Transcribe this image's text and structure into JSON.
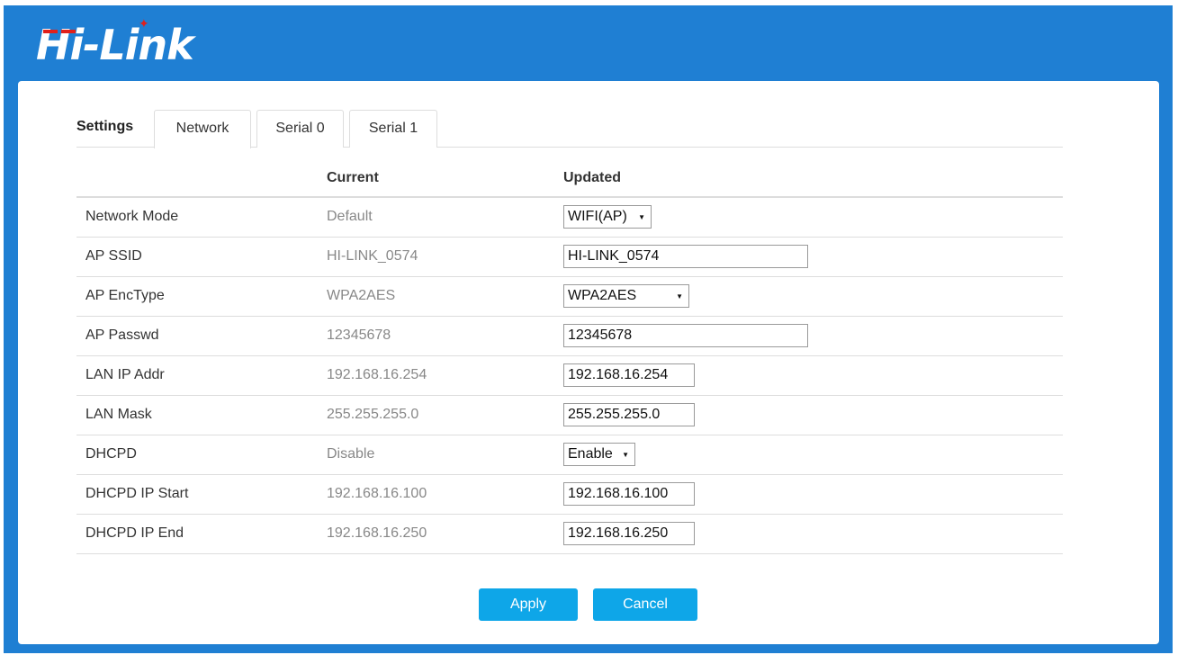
{
  "brand": {
    "logo_text": "Hi-Link",
    "accent": "#1f7fd3",
    "logo_mark_color": "#e0201c"
  },
  "tabs": {
    "section_label": "Settings",
    "items": [
      {
        "label": "Network",
        "active": true
      },
      {
        "label": "Serial 0",
        "active": false
      },
      {
        "label": "Serial 1",
        "active": false
      }
    ]
  },
  "table": {
    "headers": {
      "label": "",
      "current": "Current",
      "updated": "Updated"
    },
    "rows": [
      {
        "label": "Network Mode",
        "current": "Default",
        "updated": "WIFI(AP)",
        "control": "select"
      },
      {
        "label": "AP SSID",
        "current": "HI-LINK_0574",
        "updated": "HI-LINK_0574",
        "control": "input"
      },
      {
        "label": "AP EncType",
        "current": "WPA2AES",
        "updated": "WPA2AES",
        "control": "select"
      },
      {
        "label": "AP Passwd",
        "current": "12345678",
        "updated": "12345678",
        "control": "input"
      },
      {
        "label": "LAN IP Addr",
        "current": "192.168.16.254",
        "updated": "192.168.16.254",
        "control": "input"
      },
      {
        "label": "LAN Mask",
        "current": "255.255.255.0",
        "updated": "255.255.255.0",
        "control": "input"
      },
      {
        "label": "DHCPD",
        "current": "Disable",
        "updated": "Enable",
        "control": "select"
      },
      {
        "label": "DHCPD IP Start",
        "current": "192.168.16.100",
        "updated": "192.168.16.100",
        "control": "input"
      },
      {
        "label": "DHCPD IP End",
        "current": "192.168.16.250",
        "updated": "192.168.16.250",
        "control": "input"
      }
    ]
  },
  "actions": {
    "apply_label": "Apply",
    "cancel_label": "Cancel",
    "button_color": "#0ea6e8"
  }
}
